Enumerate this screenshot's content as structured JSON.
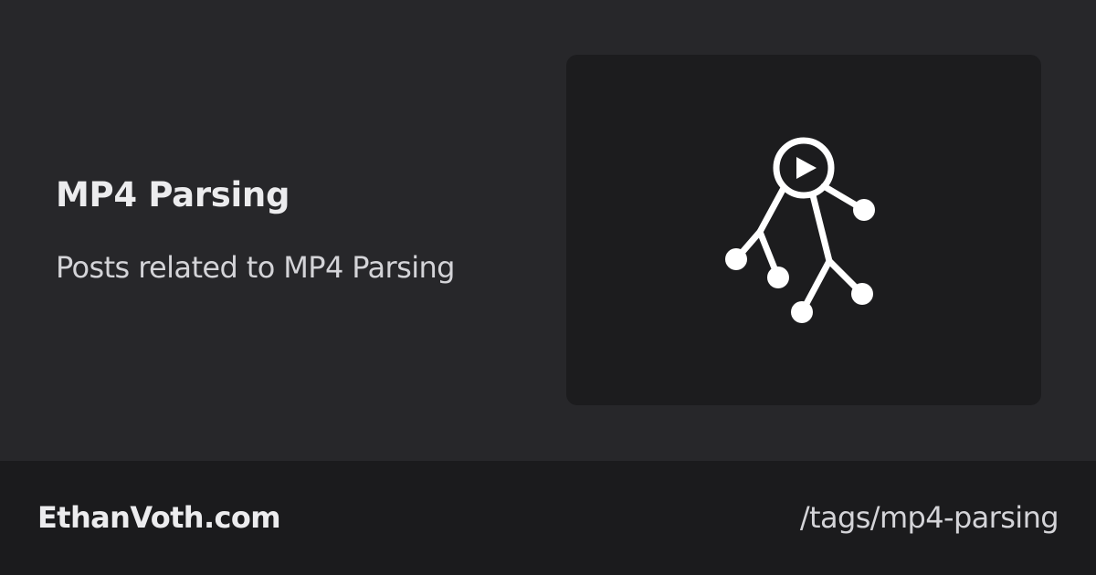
{
  "tag": {
    "title": "MP4 Parsing",
    "description": "Posts related to MP4 Parsing"
  },
  "preview": {
    "icon": "video-tree-icon"
  },
  "footer": {
    "site_name": "EthanVoth.com",
    "path": "/tags/mp4-parsing"
  },
  "colors": {
    "background": "#27272a",
    "card": "#1c1c1e",
    "footer": "#1b1b1d",
    "text_primary": "#ececee",
    "text_secondary": "#d4d4d8",
    "icon": "#ffffff"
  }
}
